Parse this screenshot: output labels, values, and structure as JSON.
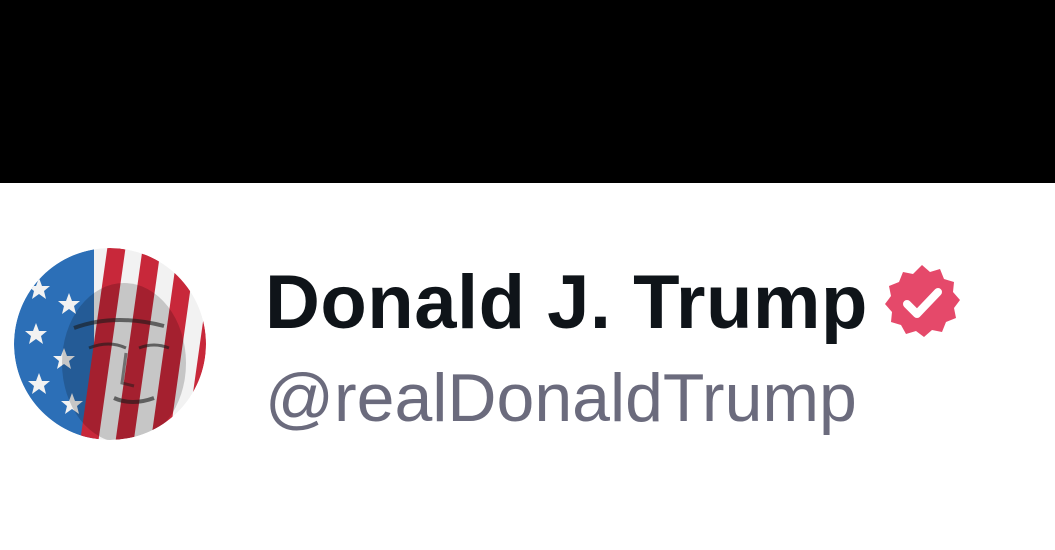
{
  "profile": {
    "display_name": "Donald J. Trump",
    "handle": "@realDonaldTrump",
    "verified": true
  },
  "icons": {
    "avatar": "flag-portrait-avatar",
    "badge": "verified-check-icon"
  },
  "colors": {
    "top_bar": "#000000",
    "background": "#ffffff",
    "name": "#0f1419",
    "handle": "#6b6b7d",
    "badge": "#e5496a",
    "flag_red": "#c8283a",
    "flag_blue": "#2c6fb7",
    "flag_white": "#f2f2f2"
  }
}
